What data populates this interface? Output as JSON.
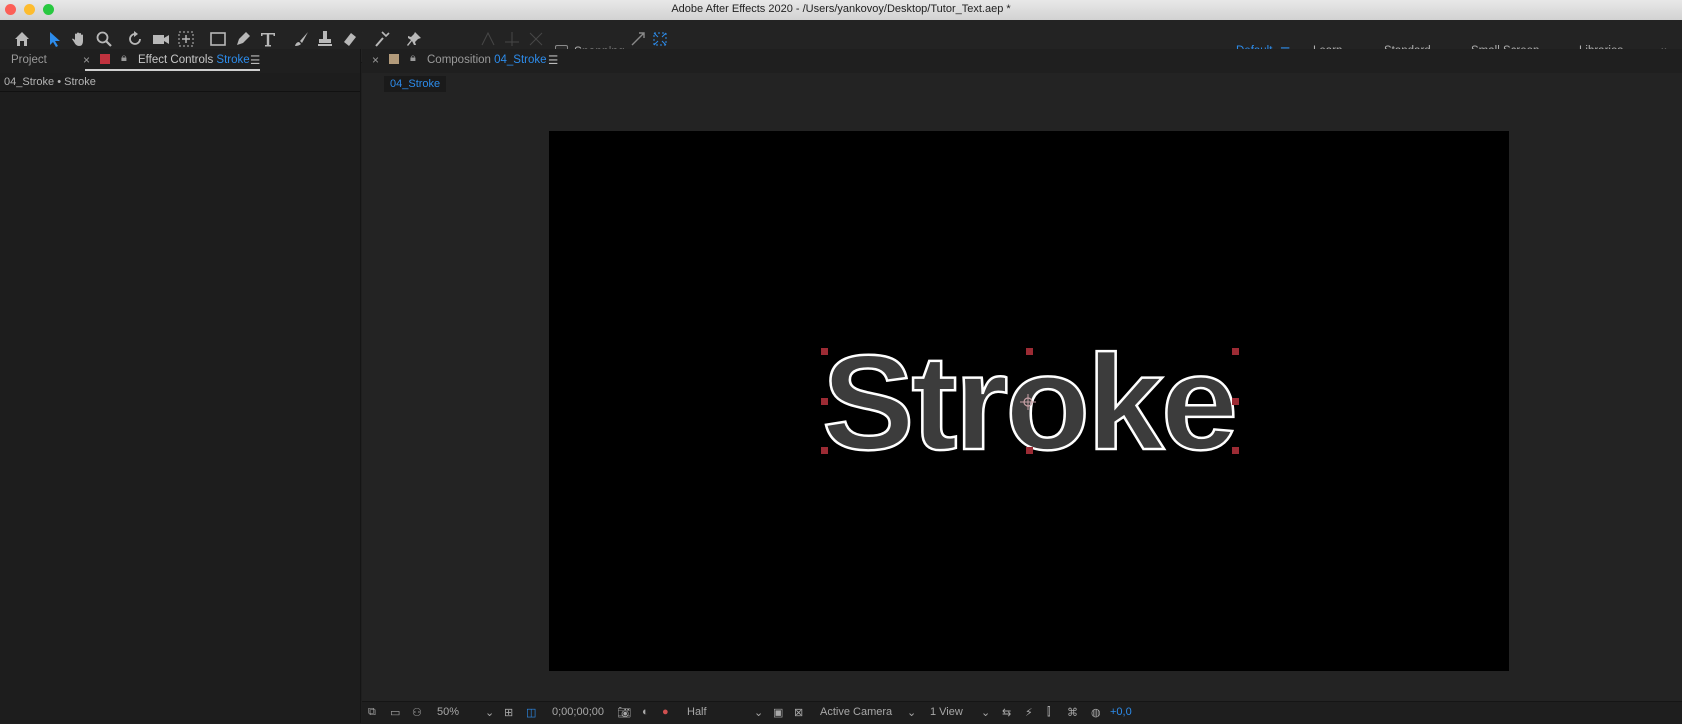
{
  "window": {
    "title": "Adobe After Effects 2020 - /Users/yankovoy/Desktop/Tutor_Text.aep *",
    "traffic_lights": [
      "#fc5f57",
      "#fdbc2e",
      "#28c840"
    ]
  },
  "toolbar": {
    "tools": [
      "home-icon",
      "selection-arrow-icon",
      "hand-icon",
      "zoom-icon",
      "rotate-icon",
      "camera-icon",
      "pan-behind-icon",
      "rectangle-icon",
      "pen-icon",
      "type-icon",
      "brush-icon",
      "clone-stamp-icon",
      "eraser-icon",
      "roto-brush-icon",
      "puppet-pin-icon"
    ],
    "snapping_label": "Snapping",
    "workspaces": [
      "Default",
      "Learn",
      "Standard",
      "Small Screen",
      "Libraries"
    ],
    "active_workspace": "Default",
    "more_icon": "»"
  },
  "left_panel": {
    "project_tab": "Project",
    "effect_controls_label": "Effect Controls",
    "effect_controls_layer": "Stroke",
    "breadcrumb": "04_Stroke • Stroke"
  },
  "composition_panel": {
    "tab_label": "Composition",
    "comp_name": "04_Stroke",
    "subtab": "04_Stroke",
    "canvas_text": "Stroke"
  },
  "viewer_controls": {
    "zoom": "50%",
    "timecode": "0;00;00;00",
    "resolution": "Half",
    "camera": "Active Camera",
    "views": "1 View",
    "exposure": "+0,0"
  },
  "colors": {
    "accent": "#2d8ceb",
    "label_red": "#c0323e",
    "label_tan": "#b29a7a",
    "handle": "#9c2b34"
  }
}
